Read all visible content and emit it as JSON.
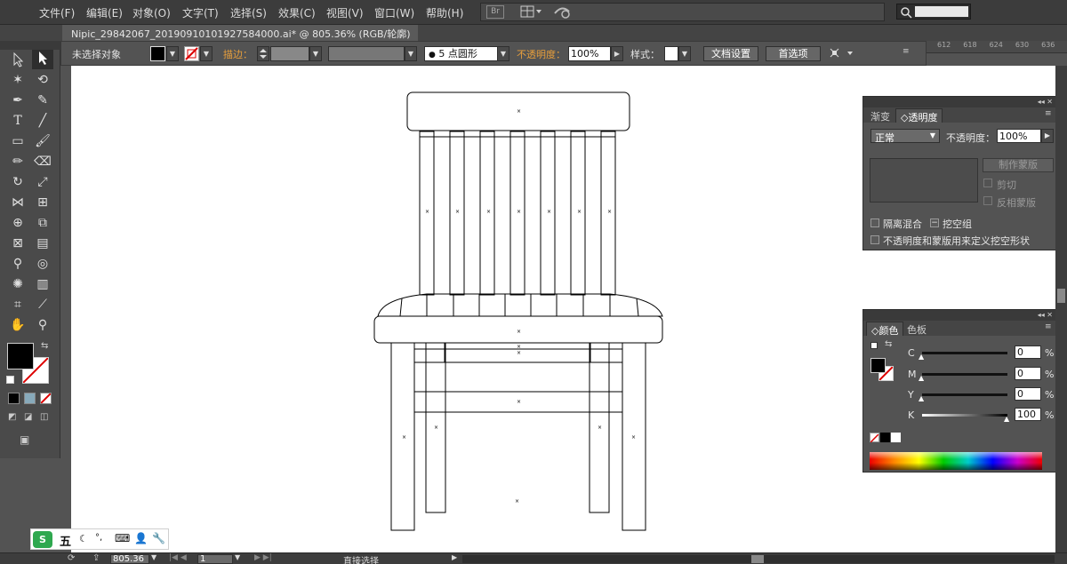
{
  "menu": [
    "文件(F)",
    "编辑(E)",
    "对象(O)",
    "文字(T)",
    "选择(S)",
    "效果(C)",
    "视图(V)",
    "窗口(W)",
    "帮助(H)"
  ],
  "menu_extra": {
    "bridge": "Br"
  },
  "document": {
    "tab_title": "Nipic_29842067_20190910101927584000.ai* @ 805.36% (RGB/轮廓)"
  },
  "ruler": [
    "612",
    "618",
    "624",
    "630",
    "636"
  ],
  "control_bar": {
    "selection": "未选择对象",
    "stroke_label": "描边：",
    "brush": "5 点圆形",
    "opacity_label": "不透明度：",
    "opacity_value": "100%",
    "style_label": "样式：",
    "doc_setup": "文档设置",
    "preferences": "首选项"
  },
  "transparency_panel": {
    "tab_gradient": "渐变",
    "tab_transparency": "透明度",
    "blend_mode": "正常",
    "opacity_label": "不透明度：",
    "opacity_value": "100%",
    "make_mask": "制作蒙版",
    "clip": "剪切",
    "invert_mask": "反相蒙版",
    "isolate_blend": "隔离混合",
    "knockout_group": "挖空组",
    "opacity_mask_define": "不透明度和蒙版用来定义挖空形状"
  },
  "color_panel": {
    "tab_color": "颜色",
    "tab_swatches": "色板",
    "channels": [
      {
        "label": "C",
        "value": "0",
        "level": 0
      },
      {
        "label": "M",
        "value": "0",
        "level": 0
      },
      {
        "label": "Y",
        "value": "0",
        "level": 0
      },
      {
        "label": "K",
        "value": "100",
        "level": 100
      }
    ],
    "percent": "%"
  },
  "status_bar": {
    "zoom": "805.36",
    "page": "1",
    "tool": "直接选择"
  },
  "ime": {
    "mode": "五"
  },
  "colors": {
    "accent_orange": "#e89f3c",
    "fill": "#000000",
    "stroke": "none"
  }
}
